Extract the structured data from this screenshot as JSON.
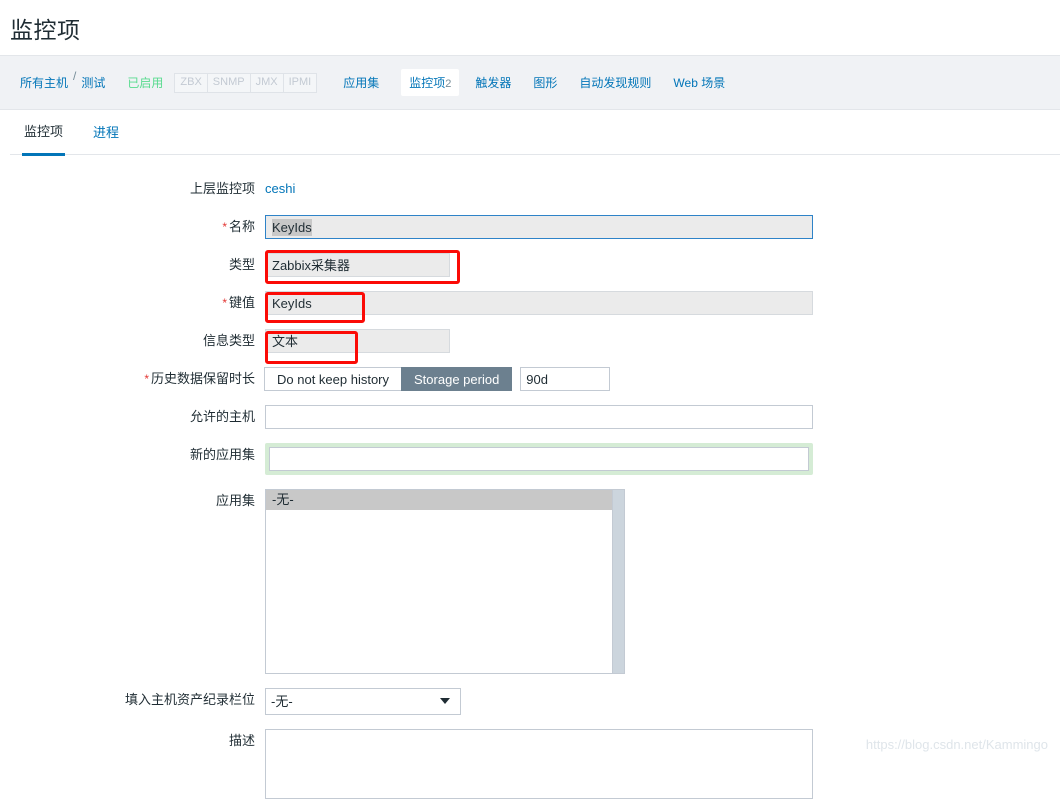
{
  "page": {
    "title": "监控项",
    "watermark": "https://blog.csdn.net/Kammingo"
  },
  "breadcrumb": {
    "all_hosts": "所有主机",
    "separator": "/",
    "host_name": "测试",
    "status": "已启用",
    "interfaces": [
      "ZBX",
      "SNMP",
      "JMX",
      "IPMI"
    ],
    "links": [
      {
        "label": "应用集",
        "count": "",
        "current": false
      },
      {
        "label": "监控项",
        "count": "2",
        "current": true
      },
      {
        "label": "触发器",
        "count": "",
        "current": false
      },
      {
        "label": "图形",
        "count": "",
        "current": false
      },
      {
        "label": "自动发现规则",
        "count": "",
        "current": false
      },
      {
        "label": "Web 场景",
        "count": "",
        "current": false
      }
    ]
  },
  "tabs": [
    {
      "label": "监控项",
      "active": true
    },
    {
      "label": "进程",
      "active": false
    }
  ],
  "form": {
    "parent_item": {
      "label": "上层监控项",
      "value": "ceshi"
    },
    "name": {
      "label": "名称",
      "required": true,
      "value": "KeyIds"
    },
    "type": {
      "label": "类型",
      "required": false,
      "value": "Zabbix采集器"
    },
    "key": {
      "label": "键值",
      "required": true,
      "value": "KeyIds"
    },
    "value_type": {
      "label": "信息类型",
      "required": false,
      "value": "文本"
    },
    "history": {
      "label": "历史数据保留时长",
      "required": true,
      "option_off": "Do not keep history",
      "option_on": "Storage period",
      "active": "Storage period",
      "period": "90d"
    },
    "allowed_hosts": {
      "label": "允许的主机",
      "value": "",
      "placeholder": ""
    },
    "new_application": {
      "label": "新的应用集",
      "value": "",
      "placeholder": ""
    },
    "applications": {
      "label": "应用集",
      "options": [
        "-无-"
      ],
      "selected": "-无-"
    },
    "inventory_field": {
      "label": "填入主机资产纪录栏位",
      "value": "-无-",
      "options": [
        "-无-"
      ]
    },
    "description": {
      "label": "描述",
      "value": "",
      "placeholder": ""
    }
  },
  "colors": {
    "accent": "#0275b8",
    "annotation": "#fb0b06",
    "enabled": "#59db8f",
    "segment_active": "#6c808f",
    "success_glow": "#d5ecd5"
  }
}
